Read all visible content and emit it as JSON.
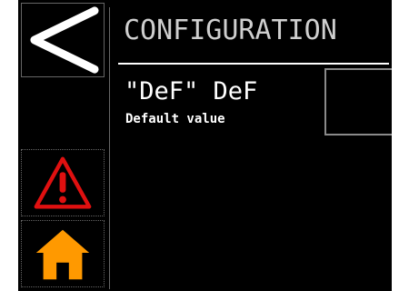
{
  "header": {
    "title": "CONFIGURATION"
  },
  "parameter": {
    "title": "\"DeF\" DeF",
    "description": "Default value",
    "checkbox_checked": false
  },
  "sidebar": {
    "buttons": [
      {
        "name": "back",
        "icon": "back-arrow-icon"
      },
      {
        "name": "alarm",
        "icon": "warning-icon"
      },
      {
        "name": "home",
        "icon": "home-icon"
      }
    ]
  },
  "colors": {
    "background": "#000000",
    "text": "#ffffff",
    "title_text": "#cfcfcf",
    "warning": "#e01010",
    "home": "#ff9900"
  }
}
